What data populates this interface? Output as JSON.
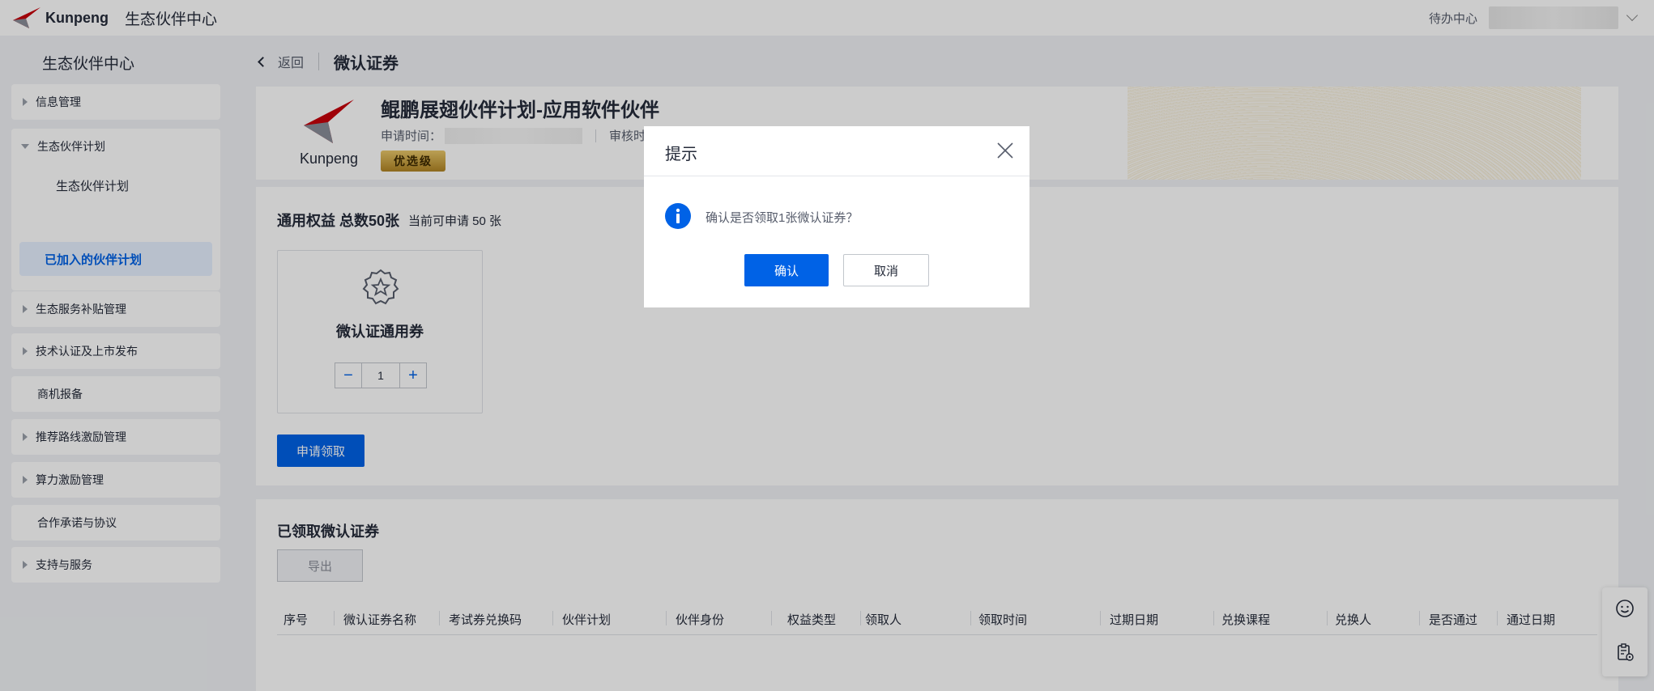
{
  "header": {
    "logo_text": "Kunpeng",
    "app_title": "生态伙伴中心",
    "todo_label": "待办中心"
  },
  "sidebar": {
    "title": "生态伙伴中心",
    "items": [
      {
        "label": "信息管理"
      },
      {
        "label": "生态伙伴计划"
      },
      {
        "label": "生态伙伴计划"
      },
      {
        "label": "已加入的伙伴计划"
      },
      {
        "label": "生态服务补贴管理"
      },
      {
        "label": "技术认证及上市发布"
      },
      {
        "label": "商机报备"
      },
      {
        "label": "推荐路线激励管理"
      },
      {
        "label": "算力激励管理"
      },
      {
        "label": "合作承诺与协议"
      },
      {
        "label": "支持与服务"
      }
    ]
  },
  "breadcrumb": {
    "back_label": "返回",
    "page_title": "微认证券"
  },
  "banner": {
    "logo_text": "Kunpeng",
    "title": "鲲鹏展翅伙伴计划-应用软件伙伴",
    "apply_time_label": "申请时间：",
    "review_time_label": "审核时间",
    "tier_badge": "优选级"
  },
  "benefits": {
    "title": "通用权益 总数50张",
    "available": "当前可申请 50 张",
    "voucher_name": "微认证通用券",
    "quantity": "1",
    "minus": "−",
    "plus": "+",
    "apply_button": "申请领取"
  },
  "claimed": {
    "title": "已领取微认证券",
    "export_button": "导出",
    "columns": [
      "序号",
      "微认证券名称",
      "考试券兑换码",
      "伙伴计划",
      "伙伴身份",
      "权益类型",
      "领取人",
      "领取时间",
      "过期日期",
      "兑换课程",
      "兑换人",
      "是否通过",
      "通过日期"
    ]
  },
  "dialog": {
    "title": "提示",
    "message": "确认是否领取1张微认证券？",
    "ok_button": "确认",
    "cancel_button": "取消"
  },
  "colors": {
    "primary": "#0062e6",
    "badge_gold": "#c9a13a"
  }
}
